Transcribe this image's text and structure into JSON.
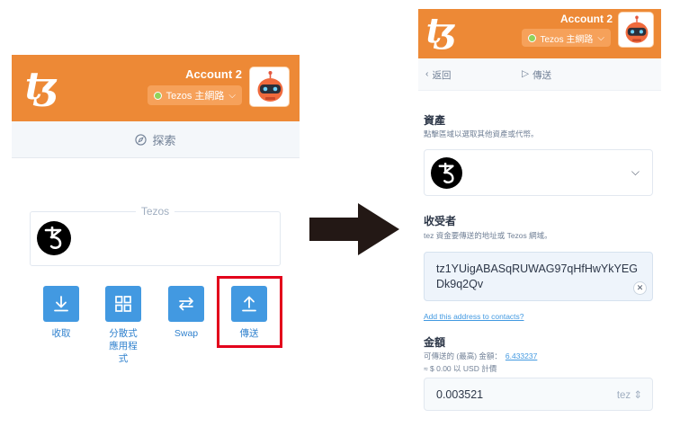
{
  "left": {
    "header": {
      "logo": "ꜩ",
      "account_name": "Account 2",
      "network": "Tezos 主網路",
      "network_color": "#8fd35a",
      "brand_color": "#ed8936"
    },
    "explore_label": "探索",
    "asset": {
      "label": "Tezos",
      "icon": "tezos-icon"
    },
    "actions": [
      {
        "label": "收取",
        "icon": "download-icon"
      },
      {
        "label": "分散式\n應用程\n式",
        "icon": "grid-icon"
      },
      {
        "label": "Swap",
        "icon": "swap-icon"
      },
      {
        "label": "傳送",
        "icon": "upload-icon"
      }
    ],
    "highlight_color": "#e3001b"
  },
  "right": {
    "header": {
      "logo": "ꜩ",
      "account_name": "Account 2",
      "network": "Tezos 主網路"
    },
    "nav": {
      "back_label": "返回",
      "title": "傳送"
    },
    "asset_section": {
      "title": "資產",
      "description": "點擊區域以選取其他資產或代幣。"
    },
    "recipient_section": {
      "title": "收受者",
      "description": "tez 資金要傳送的地址或 Tezos 網域。",
      "address": "tz1YUigABASqRUWAG97qHfHwYkYEGDk9q2Qv",
      "add_contact_link": "Add this address to contacts?"
    },
    "amount_section": {
      "title": "金額",
      "available_label": "可傳送的 (最高) 金額：",
      "available_value": "6.433237",
      "usd_line": "≈ $ 0.00 以 USD 計價",
      "amount": "0.003521",
      "unit": "tez"
    }
  }
}
